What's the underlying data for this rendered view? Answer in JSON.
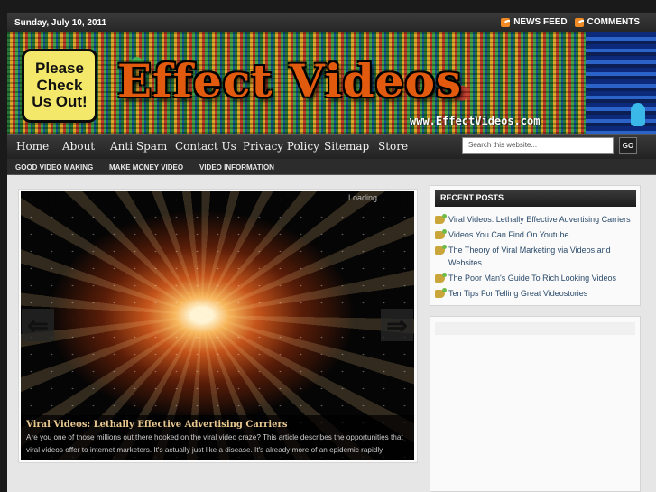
{
  "topbar": {
    "date": "Sunday, July 10, 2011",
    "news_feed": "NEWS FEED",
    "comments": "COMMENTS"
  },
  "banner": {
    "badge_lines": [
      "Please",
      "Check",
      "Us Out!"
    ],
    "logo": "Effect Videos",
    "url": "www.EffectVideos.com"
  },
  "nav": {
    "items": [
      "Home",
      "About",
      "Anti Spam",
      "Contact Us",
      "Privacy Policy",
      "Sitemap",
      "Store"
    ],
    "search_placeholder": "Search this website...",
    "go_label": "GO"
  },
  "subnav": {
    "items": [
      "GOOD VIDEO MAKING",
      "MAKE MONEY VIDEO",
      "VIDEO INFORMATION"
    ]
  },
  "slider": {
    "loading": "Loading...",
    "prev_glyph": "⇐",
    "next_glyph": "⇒",
    "caption_title": "Viral Videos: Lethally Effective Advertising Carriers",
    "caption_text": "Are you one of those millions out there hooked on the viral video craze? This article describes the opportunities that viral videos offer to internet marketers. It's actually just like a disease. It's already more of an epidemic rapidly"
  },
  "sidebar": {
    "recent_posts_title": "RECENT POSTS",
    "recent_posts": [
      "Viral Videos: Lethally Effective Advertising Carriers",
      "Videos You Can Find On Youtube",
      "The Theory of Viral Marketing via Videos and Websites",
      "The Poor Man's Guide To Rich Looking Videos",
      "Ten Tips For Telling Great Videostories"
    ]
  },
  "colors": {
    "accent_orange": "#e25a0d",
    "rss_orange": "#f08a24",
    "link_blue": "#2a4a6a",
    "nav_dark": "#222222"
  }
}
